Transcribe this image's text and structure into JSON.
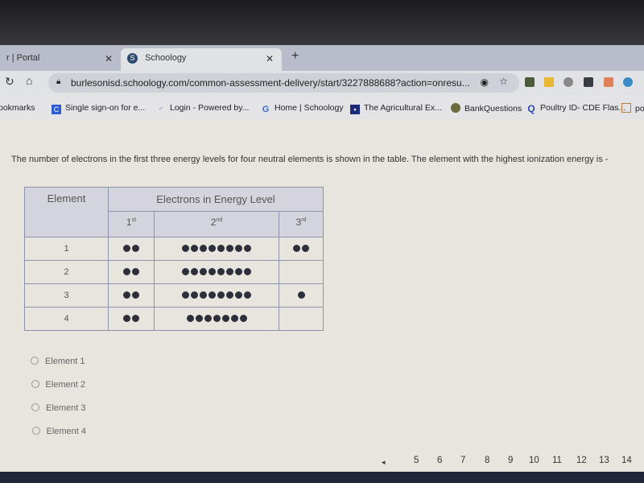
{
  "browser": {
    "tabs": [
      {
        "label": "r | Portal",
        "active": false
      },
      {
        "label": "Schoology",
        "active": true,
        "icon": "schoology-s-icon"
      }
    ],
    "url": "burlesonisd.schoology.com/common-assessment-delivery/start/3227888688?action=onresu...",
    "bookmarks": [
      "ookmarks",
      "Single sign-on for e...",
      "Login - Powered by...",
      "Home | Schoology",
      "The Agricultural Ex...",
      "BankQuestions",
      "Poultry ID- CDE Flas...",
      "po"
    ]
  },
  "question": {
    "text": "The number of electrons in the first three energy levels for four neutral elements is shown in the table. The element with the highest ionization energy is -",
    "table": {
      "header_element": "Element",
      "header_group": "Electrons in Energy Level",
      "levels": [
        {
          "n": "1",
          "sup": "st"
        },
        {
          "n": "2",
          "sup": "nd"
        },
        {
          "n": "3",
          "sup": "rd"
        }
      ],
      "rows": [
        {
          "element": "1",
          "electrons": [
            2,
            8,
            2
          ]
        },
        {
          "element": "2",
          "electrons": [
            2,
            8,
            0
          ]
        },
        {
          "element": "3",
          "electrons": [
            2,
            8,
            1
          ]
        },
        {
          "element": "4",
          "electrons": [
            2,
            7,
            0
          ]
        }
      ]
    },
    "options": [
      "Element 1",
      "Element 2",
      "Element 3",
      "Element 4"
    ]
  },
  "pagination": {
    "prev": "◂",
    "pages": [
      "5",
      "6",
      "7",
      "8",
      "9",
      "10",
      "11",
      "12",
      "13",
      "14"
    ]
  }
}
